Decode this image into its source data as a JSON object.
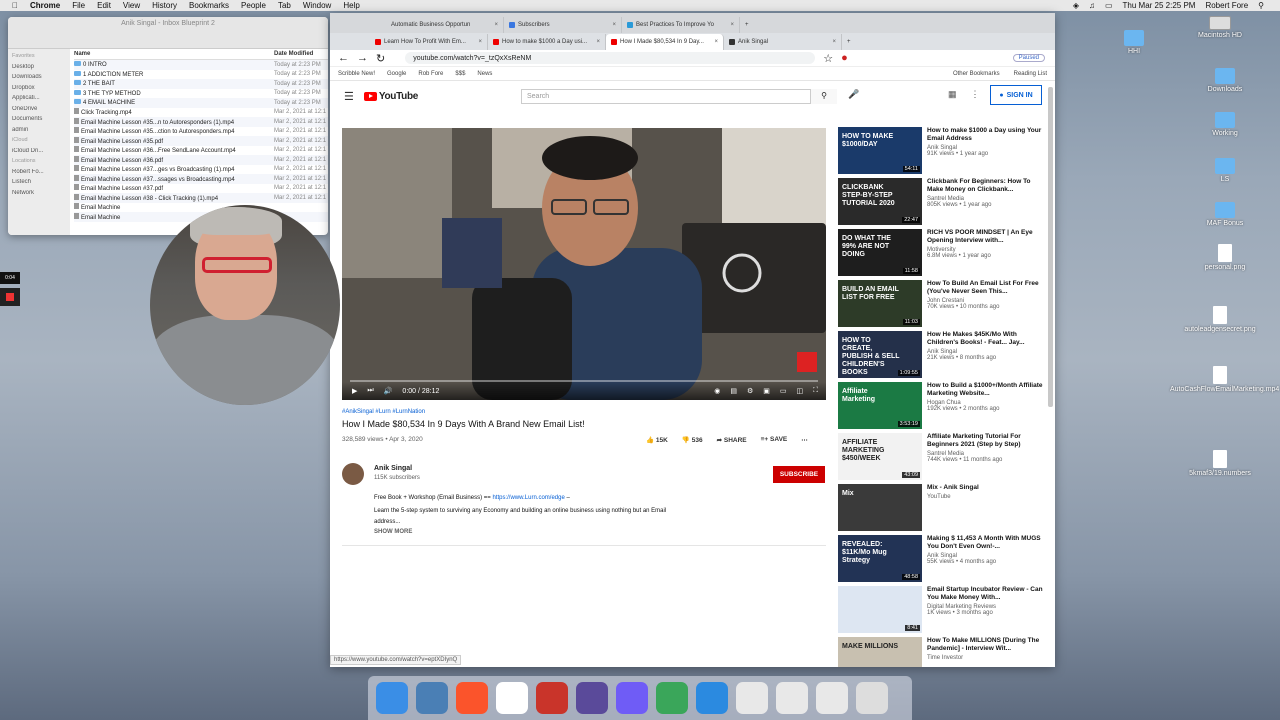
{
  "menubar": {
    "apple": "",
    "items": [
      "Chrome",
      "File",
      "Edit",
      "View",
      "History",
      "Bookmarks",
      "People",
      "Tab",
      "Window",
      "Help"
    ],
    "datetime": "Thu Mar 25  2:25 PM",
    "user": "Robert Fore"
  },
  "finder": {
    "title": "Anik Singal - Inbox Blueprint 2",
    "sidebar": [
      "Favorites",
      "Desktop",
      "Downloads",
      "Dropbox",
      "Applicati...",
      "OneDrive",
      "Documents",
      "admin",
      "iCloud",
      "iCloud Dri...",
      "Locations",
      "Robert Fo...",
      "Listech",
      "Network"
    ],
    "col_name": "Name",
    "col_date": "Date Modified",
    "rows": [
      {
        "name": "0 INTRO",
        "date": "Today at 2:23 PM",
        "type": "folder"
      },
      {
        "name": "1 ADDICTION METER",
        "date": "Today at 2:23 PM",
        "type": "folder"
      },
      {
        "name": "2 THE BAIT",
        "date": "Today at 2:23 PM",
        "type": "folder"
      },
      {
        "name": "3 THE TYP METHOD",
        "date": "Today at 2:23 PM",
        "type": "folder"
      },
      {
        "name": "4 EMAIL MACHINE",
        "date": "Today at 2:23 PM",
        "type": "folder"
      },
      {
        "name": "Click Tracking.mp4",
        "date": "Mar 2, 2021 at 12:1",
        "type": "file"
      },
      {
        "name": "Email Machine Lesson #35...n to Autoresponders (1).mp4",
        "date": "Mar 2, 2021 at 12:1",
        "type": "file"
      },
      {
        "name": "Email Machine Lesson #35...ction to Autoresponders.mp4",
        "date": "Mar 2, 2021 at 12:1",
        "type": "file"
      },
      {
        "name": "Email Machine Lesson #35.pdf",
        "date": "Mar 2, 2021 at 12:1",
        "type": "file"
      },
      {
        "name": "Email Machine Lesson #36...Free SendLane Account.mp4",
        "date": "Mar 2, 2021 at 12:1",
        "type": "file"
      },
      {
        "name": "Email Machine Lesson #36.pdf",
        "date": "Mar 2, 2021 at 12:1",
        "type": "file"
      },
      {
        "name": "Email Machine Lesson #37...ges vs Broadcasting (1).mp4",
        "date": "Mar 2, 2021 at 12:1",
        "type": "file"
      },
      {
        "name": "Email Machine Lesson #37...ssages vs Broadcasting.mp4",
        "date": "Mar 2, 2021 at 12:1",
        "type": "file"
      },
      {
        "name": "Email Machine Lesson #37.pdf",
        "date": "Mar 2, 2021 at 12:1",
        "type": "file"
      },
      {
        "name": "Email Machine Lesson #38 - Click Tracking (1).mp4",
        "date": "Mar 2, 2021 at 12:1",
        "type": "file"
      },
      {
        "name": "Email Machine",
        "date": "",
        "type": "file"
      },
      {
        "name": "Email Machine",
        "date": "",
        "type": "file"
      }
    ]
  },
  "browser": {
    "tabs_row1": [
      {
        "label": "Automatic Business Opportun",
        "active": false
      },
      {
        "label": "Subscribers",
        "active": false
      },
      {
        "label": "Best Practices To Improve Yo",
        "active": false
      }
    ],
    "tabs_row2": [
      {
        "label": "Learn How To Profit With Em...",
        "active": false
      },
      {
        "label": "How to make $1000 a Day usi...",
        "active": false
      },
      {
        "label": "How I Made $80,534 In 9 Day...",
        "active": true
      },
      {
        "label": "Anik Singal",
        "active": false
      }
    ],
    "url": "youtube.com/watch?v=_tzQxXsReNM",
    "paused": "Paused",
    "bookmarks": [
      "Scribble New!",
      "Google",
      "Rob Fore",
      "$$$",
      "News"
    ],
    "other_bookmarks": "Other Bookmarks",
    "reading_list": "Reading List"
  },
  "youtube": {
    "logo": "YouTube",
    "search_placeholder": "Search",
    "signin": "SIGN IN",
    "player": {
      "time": "0:00 / 28:12"
    },
    "hashtags": "#AnikSingal #Lurn #LurnNation",
    "title": "How I Made $80,534 In 9 Days With A Brand New Email List!",
    "stats": "328,589 views • Apr 3, 2020",
    "likes": "15K",
    "dislikes": "536",
    "share": "SHARE",
    "save": "SAVE",
    "channel": "Anik Singal",
    "subscribers": "115K subscribers",
    "subscribe": "SUBSCRIBE",
    "desc_line1": "Free Book + Workshop (Email Business) ==",
    "desc_link": "https://www.Lurn.com/edge",
    "desc_line1_end": "–",
    "desc_line2": "Learn the 5-step system to surviving any Economy and building an online business using nothing but an Email address...",
    "show_more": "SHOW MORE",
    "status_url": "https://www.youtube.com/watch?v=eptXDIynQ"
  },
  "related": [
    {
      "title": "How to make $1000 a Day using Your Email Address",
      "channel": "Anik Singal",
      "views": "91K views • 1 year ago",
      "duration": "54:11",
      "thumb_text": "HOW TO MAKE $1000/DAY",
      "color": "#1a3a6a"
    },
    {
      "title": "Clickbank For Beginners: How To Make Money on Clickbank...",
      "channel": "Santrel Media",
      "views": "805K views • 1 year ago",
      "duration": "22:47",
      "thumb_text": "CLICKBANK STEP-BY-STEP TUTORIAL 2020",
      "color": "#2a2a2a"
    },
    {
      "title": "RICH VS POOR MINDSET | An Eye Opening Interview with...",
      "channel": "Motiversity",
      "views": "6.8M views • 1 year ago",
      "duration": "11:58",
      "thumb_text": "DO WHAT THE 99% ARE NOT DOING",
      "color": "#1e1e1e"
    },
    {
      "title": "How To Build An Email List For Free (You've Never Seen This...",
      "channel": "John Crestani",
      "views": "70K views • 10 months ago",
      "duration": "11:03",
      "thumb_text": "BUILD AN EMAIL LIST FOR FREE",
      "color": "#2d3b28"
    },
    {
      "title": "How He Makes $45K/Mo With Children's Books! - Feat... Jay...",
      "channel": "Anik Singal",
      "views": "21K views • 8 months ago",
      "duration": "1:09:55",
      "thumb_text": "HOW TO CREATE, PUBLISH & SELL CHILDREN'S BOOKS",
      "color": "#24304a"
    },
    {
      "title": "How to Build a $1000+/Month Affiliate Marketing Website...",
      "channel": "Hogan Chua",
      "views": "192K views • 2 months ago",
      "duration": "3:53:19",
      "thumb_text": "Affiliate Marketing",
      "color": "#1b7a44"
    },
    {
      "title": "Affiliate Marketing Tutorial For Beginners 2021 (Step by Step)",
      "channel": "Santrel Media",
      "views": "744K views • 11 months ago",
      "duration": "43:09",
      "thumb_text": "AFFILIATE MARKETING $450/WEEK",
      "color": "#f2f2f2"
    },
    {
      "title": "Mix - Anik Singal",
      "channel": "YouTube",
      "views": "",
      "duration": "",
      "thumb_text": "Mix",
      "color": "#3a3a3a"
    },
    {
      "title": "Making $ 11,453 A Month With MUGS You Don't Even Own!-...",
      "channel": "Anik Singal",
      "views": "55K views • 4 months ago",
      "duration": "48:58",
      "thumb_text": "REVEALED: $11K/Mo Mug Strategy",
      "color": "#223355"
    },
    {
      "title": "Email Startup Incubator Review - Can You Make Money With...",
      "channel": "Digital Marketing Reviews",
      "views": "1K views • 3 months ago",
      "duration": "8:41",
      "thumb_text": "",
      "color": "#dde6f2"
    },
    {
      "title": "How To Make MILLIONS [During The Pandemic] - Interview Wit...",
      "channel": "Time Investor",
      "views": "",
      "duration": "",
      "thumb_text": "MAKE MILLIONS",
      "color": "#c8c0b0"
    }
  ],
  "recorder": {
    "time": "0:04"
  },
  "desktop": [
    {
      "label": "HHI",
      "kind": "folder"
    },
    {
      "label": "Macintosh HD",
      "kind": "hd"
    },
    {
      "label": "Downloads",
      "kind": "folder"
    },
    {
      "label": "Working",
      "kind": "folder"
    },
    {
      "label": "LS",
      "kind": "folder"
    },
    {
      "label": "MAF Bonus",
      "kind": "folder"
    },
    {
      "label": "personal.png",
      "kind": "doc"
    },
    {
      "label": "autoleadgensecret.png",
      "kind": "doc"
    },
    {
      "label": "AutoCashFlowEmailMarketing.mp4",
      "kind": "doc"
    },
    {
      "label": "5kmaf3/19.numbers",
      "kind": "doc"
    }
  ],
  "dock": [
    "Finder",
    "Preview",
    "Brave",
    "Chrome",
    "Scrivener",
    "BBEdit",
    "Messenger",
    "Numbers",
    "Edge",
    "Window 1",
    "Window 2",
    "Window 3",
    "Trash"
  ]
}
